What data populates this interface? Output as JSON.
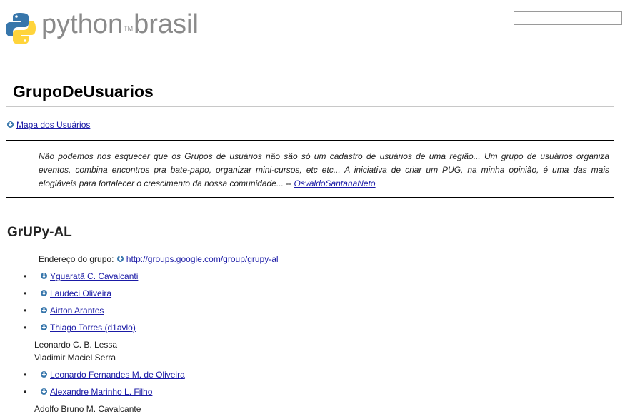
{
  "header": {
    "logo_text": "python",
    "logo_tm": "TM",
    "logo_text2": "brasil",
    "search": {
      "value": "",
      "placeholder": ""
    }
  },
  "page": {
    "title": "GrupoDeUsuarios",
    "map_link": "Mapa dos Usuários",
    "quote": {
      "text": "Não podemos nos esquecer que os Grupos de usuários não são só um cadastro de usuários de uma região... Um grupo de usuários organiza eventos, combina encontros pra bate-papo, organizar mini-cursos, etc etc... A iniciativa de criar um PUG, na minha opinião, é uma das mais elogiáveis para fortalecer o crescimento da nossa comunidade... --",
      "author_link": "OsvaldoSantanaNeto"
    }
  },
  "section": {
    "title": "GrUPy-AL",
    "address_label": "Endereço do grupo:",
    "address_link": "http://groups.google.com/group/grupy-al",
    "members": [
      {
        "name": "Yguaratã C. Cavalcanti",
        "link": true
      },
      {
        "name": "Laudeci Oliveira",
        "link": true
      },
      {
        "name": "Airton Arantes",
        "link": true
      },
      {
        "name": "Thiago Torres (d1avlo)",
        "link": true
      },
      {
        "name": "Leonardo C. B. Lessa",
        "link": false
      },
      {
        "name": "Vladimir Maciel Serra",
        "link": false
      },
      {
        "name": "Leonardo Fernandes M. de Oliveira",
        "link": true
      },
      {
        "name": "Alexandre Marinho L. Filho",
        "link": true
      },
      {
        "name": "Adolfo Bruno M. Cavalcante",
        "link": false
      }
    ]
  },
  "colors": {
    "link": "#1a1aa6",
    "python_blue": "#3776ab",
    "python_yellow": "#ffd43b",
    "rule": "#c8c8c8"
  },
  "icons": {
    "interwiki": "interwiki-link-icon",
    "logo": "python-logo-icon"
  }
}
